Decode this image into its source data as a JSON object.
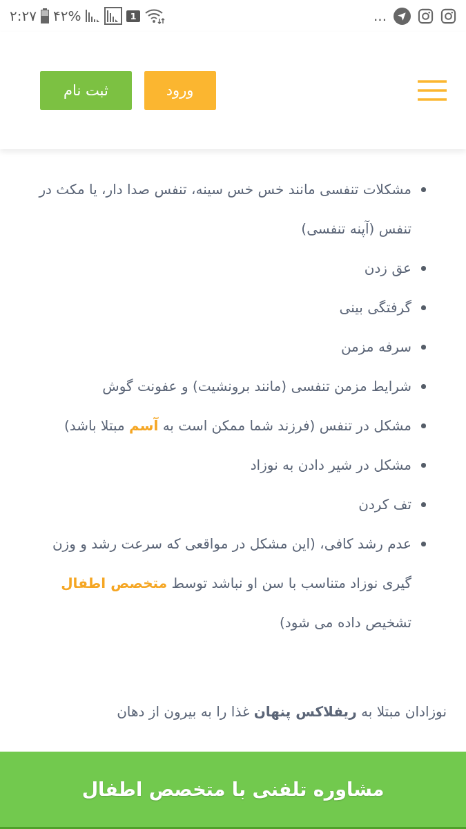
{
  "status_bar": {
    "time": "۲:۲۷",
    "battery": "۴۲%",
    "sim": "1",
    "more": "..."
  },
  "header": {
    "buttons": [
      {
        "label": "ورود",
        "kind": "login"
      },
      {
        "label": "ثبت نام",
        "kind": "signup"
      }
    ]
  },
  "list": [
    "مشکلات تنفسی مانند خس خس سینه، تنفس صدا دار، یا مکث در تنفس (آپنه تنفسی)",
    "عق زدن",
    "گرفتگی بینی",
    "سرفه مزمن",
    "شرایط مزمن تنفسی (مانند برونشیت) و عفونت گوش",
    "مشکل در تنفس (فرزند شما ممکن است به **آسم** مبتلا باشد)",
    "مشکل در شیر دادن به نوزاد",
    "تف کردن",
    "عدم رشد کافی، (این مشکل در مواقعی که سرعت رشد و وزن گیری نوزاد متناسب با سن او نباشد توسط **متخصص اطفال** تشخیص داده می شود)"
  ],
  "paragraph": "نوزادان مبتلا به **ریفلاکس پنهان** غذا را به بیرون از دهان",
  "bottom_bar": {
    "label": "مشاوره تلفنی با متخصص اطفال"
  }
}
